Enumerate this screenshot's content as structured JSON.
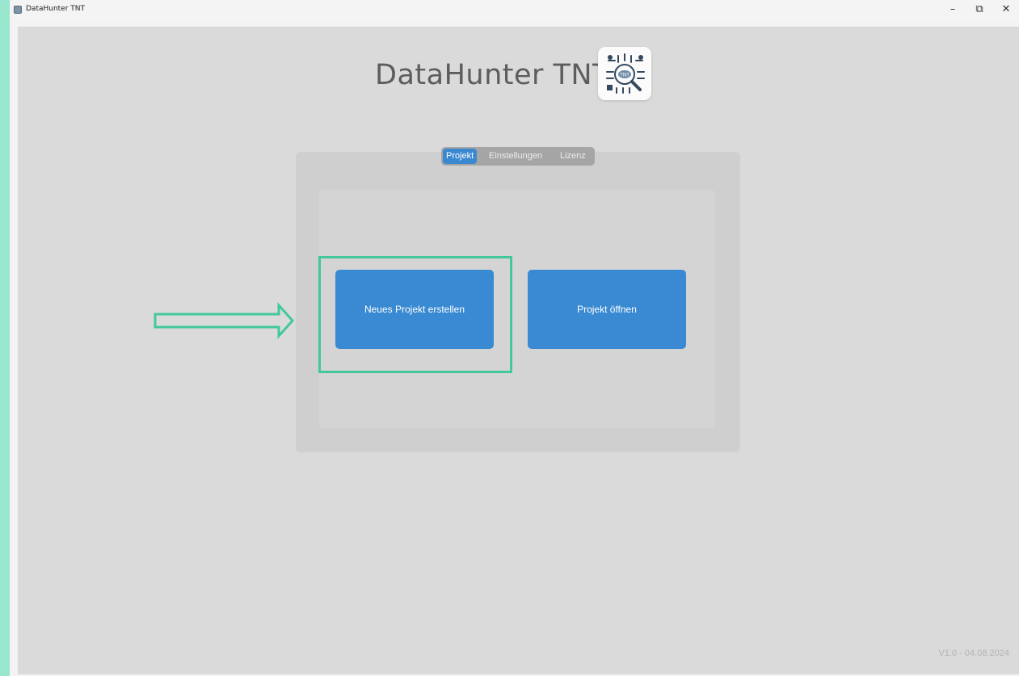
{
  "window": {
    "title": "DataHunter TNT",
    "controls": {
      "minimize": "–",
      "restore": "⧉",
      "close": "✕"
    }
  },
  "header": {
    "app_title": "DataHunter TNT",
    "logo_icon": "magnifier-circuit-logo"
  },
  "tabs": [
    {
      "label": "Projekt",
      "active": true
    },
    {
      "label": "Einstellungen",
      "active": false
    },
    {
      "label": "Lizenz",
      "active": false
    }
  ],
  "actions": {
    "new_project": "Neues Projekt erstellen",
    "open_project": "Projekt öffnen"
  },
  "footer": {
    "version": "V1.0 - 04.08.2024"
  },
  "colors": {
    "accent": "#3a8ad3",
    "highlight": "#42c89a",
    "background_outer": "#97e6cd",
    "app_background": "#dadada"
  }
}
